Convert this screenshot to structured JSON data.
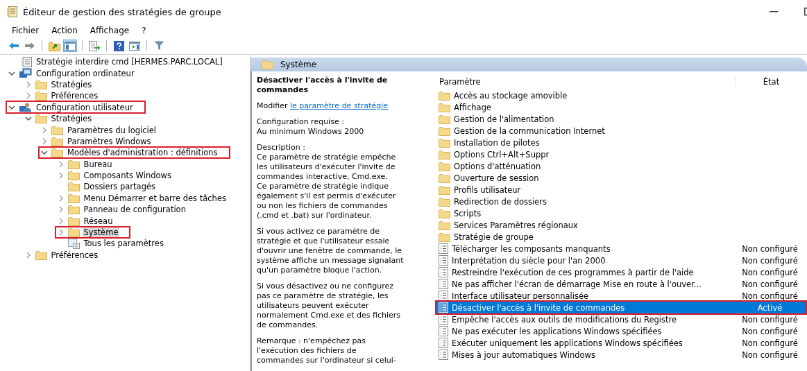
{
  "window": {
    "title": "Éditeur de gestion des stratégies de groupe"
  },
  "menu": [
    "Fichier",
    "Action",
    "Affichage",
    "?"
  ],
  "toolbar": [
    [
      {
        "kind": "back",
        "pressed": false
      },
      {
        "kind": "forward",
        "pressed": false
      }
    ],
    [
      {
        "kind": "up",
        "pressed": false
      },
      {
        "kind": "tree",
        "pressed": true
      }
    ],
    [
      {
        "kind": "export",
        "pressed": false
      }
    ],
    [
      {
        "kind": "help",
        "pressed": false
      },
      {
        "kind": "view",
        "pressed": false
      }
    ],
    [
      {
        "kind": "filter",
        "pressed": false
      }
    ]
  ],
  "tree": {
    "root": {
      "label": "Stratégie interdire cmd [HERMES.PARC.LOCAL]"
    },
    "children": [
      {
        "label": "Configuration ordinateur",
        "kind": "computer",
        "has_children": true,
        "expanded": true,
        "selected": false,
        "highlighted": false,
        "children": [
          {
            "label": "Stratégies",
            "kind": "folder",
            "has_children": true,
            "expanded": false,
            "selected": false,
            "highlighted": false
          },
          {
            "label": "Préférences",
            "kind": "folder",
            "has_children": true,
            "expanded": false,
            "selected": false,
            "highlighted": false
          }
        ]
      },
      {
        "label": "Configuration utilisateur",
        "kind": "user",
        "has_children": true,
        "expanded": true,
        "selected": false,
        "highlighted": true,
        "children": [
          {
            "label": "Stratégies",
            "kind": "folder",
            "has_children": true,
            "expanded": true,
            "selected": false,
            "highlighted": false,
            "children": [
              {
                "label": "Paramètres du logiciel",
                "kind": "folder",
                "has_children": true,
                "expanded": false,
                "selected": false,
                "highlighted": false
              },
              {
                "label": "Paramètres Windows",
                "kind": "folder",
                "has_children": true,
                "expanded": false,
                "selected": false,
                "highlighted": false
              },
              {
                "label": "Modèles d'administration : définitions",
                "kind": "folder",
                "has_children": true,
                "expanded": true,
                "selected": false,
                "highlighted": true,
                "children": [
                  {
                    "label": "Bureau",
                    "kind": "folder",
                    "has_children": true,
                    "expanded": false,
                    "selected": false,
                    "highlighted": false
                  },
                  {
                    "label": "Composants Windows",
                    "kind": "folder",
                    "has_children": true,
                    "expanded": false,
                    "selected": false,
                    "highlighted": false
                  },
                  {
                    "label": "Dossiers partagés",
                    "kind": "folder",
                    "has_children": false,
                    "selected": false,
                    "highlighted": false
                  },
                  {
                    "label": "Menu Démarrer et barre des tâches",
                    "kind": "folder",
                    "has_children": true,
                    "expanded": false,
                    "selected": false,
                    "highlighted": false
                  },
                  {
                    "label": "Panneau de configuration",
                    "kind": "folder",
                    "has_children": true,
                    "expanded": false,
                    "selected": false,
                    "highlighted": false
                  },
                  {
                    "label": "Réseau",
                    "kind": "folder",
                    "has_children": true,
                    "expanded": false,
                    "selected": false,
                    "highlighted": false
                  },
                  {
                    "label": "Système",
                    "kind": "folder",
                    "has_children": true,
                    "expanded": false,
                    "selected": true,
                    "highlighted": true
                  },
                  {
                    "label": "Tous les paramètres",
                    "kind": "settings",
                    "has_children": false,
                    "selected": false,
                    "highlighted": false
                  }
                ]
              }
            ]
          },
          {
            "label": "Préférences",
            "kind": "folder",
            "has_children": true,
            "expanded": false,
            "selected": false,
            "highlighted": false
          }
        ]
      }
    ]
  },
  "pane_header": "Système",
  "description": {
    "title": "Désactiver l'accès à l'invite de commandes",
    "edit_prefix": "Modifier",
    "edit_link": "le paramètre de stratégie",
    "paragraphs": [
      [
        "Configuration requise :",
        "Au minimum Windows 2000"
      ],
      [
        "Description :",
        "Ce paramètre de stratégie empêche",
        "les utilisateurs d'exécuter l'invite de",
        "commandes interactive, Cmd.exe.",
        "Ce paramètre de stratégie indique",
        "également s'il est permis d'exécuter",
        "ou non les fichiers de commandes",
        "(.cmd et .bat) sur l'ordinateur."
      ],
      [
        "Si vous activez ce paramètre de",
        "stratégie et que l'utilisateur essaie",
        "d'ouvrir une fenêtre de commande, le",
        "système affiche un message signalant",
        "qu'un paramètre bloque l'action."
      ],
      [
        "Si vous désactivez ou ne configurez",
        "pas ce paramètre de stratégie, les",
        "utilisateurs peuvent exécuter",
        "normalement Cmd.exe et des fichiers",
        "de commandes."
      ],
      [
        "Remarque : n'empêchez pas",
        "l'exécution des fichiers de",
        "commandes sur l'ordinateur si celui-"
      ]
    ]
  },
  "table": {
    "columns": [
      "Paramètre",
      "État"
    ],
    "rows": [
      {
        "kind": "folder",
        "name": "Accès au stockage amovible",
        "selected": false,
        "highlighted": false
      },
      {
        "kind": "folder",
        "name": "Affichage",
        "selected": false,
        "highlighted": false
      },
      {
        "kind": "folder",
        "name": "Gestion de l'alimentation",
        "selected": false,
        "highlighted": false
      },
      {
        "kind": "folder",
        "name": "Gestion de la communication Internet",
        "selected": false,
        "highlighted": false
      },
      {
        "kind": "folder",
        "name": "Installation de pilotes",
        "selected": false,
        "highlighted": false
      },
      {
        "kind": "folder",
        "name": "Options Ctrl+Alt+Suppr",
        "selected": false,
        "highlighted": false
      },
      {
        "kind": "folder",
        "name": "Options d'atténuation",
        "selected": false,
        "highlighted": false
      },
      {
        "kind": "folder",
        "name": "Ouverture de session",
        "selected": false,
        "highlighted": false
      },
      {
        "kind": "folder",
        "name": "Profils utilisateur",
        "selected": false,
        "highlighted": false
      },
      {
        "kind": "folder",
        "name": "Redirection de dossiers",
        "selected": false,
        "highlighted": false
      },
      {
        "kind": "folder",
        "name": "Scripts",
        "selected": false,
        "highlighted": false
      },
      {
        "kind": "folder",
        "name": "Services Paramètres régionaux",
        "selected": false,
        "highlighted": false
      },
      {
        "kind": "folder",
        "name": "Stratégie de groupe",
        "selected": false,
        "highlighted": false
      },
      {
        "kind": "setting",
        "name": "Télécharger les composants manquants",
        "state": "Non configuré",
        "selected": false,
        "highlighted": false
      },
      {
        "kind": "setting",
        "name": "Interprétation du siècle pour l'an 2000",
        "state": "Non configuré",
        "selected": false,
        "highlighted": false
      },
      {
        "kind": "setting",
        "name": "Restreindre l'exécution de ces programmes à partir de l'aide",
        "state": "Non configuré",
        "selected": false,
        "highlighted": false
      },
      {
        "kind": "setting",
        "name": "Ne pas afficher l'écran de démarrage Mise en route à l'ouver...",
        "state": "Non configuré",
        "selected": false,
        "highlighted": false
      },
      {
        "kind": "setting",
        "name": "Interface utilisateur personnalisée",
        "state": "Non configuré",
        "selected": false,
        "highlighted": false
      },
      {
        "kind": "setting",
        "name": "Désactiver l'accès à l'invite de commandes",
        "state": "Activé",
        "selected": true,
        "highlighted": true
      },
      {
        "kind": "setting",
        "name": "Empêche l'accès aux outils de modifications du Registre",
        "state": "Non configuré",
        "selected": false,
        "highlighted": false
      },
      {
        "kind": "setting",
        "name": "Ne pas exécuter les applications Windows spécifiées",
        "state": "Non configuré",
        "selected": false,
        "highlighted": false
      },
      {
        "kind": "setting",
        "name": "Exécuter uniquement les applications Windows spécifiées",
        "state": "Non configuré",
        "selected": false,
        "highlighted": false
      },
      {
        "kind": "setting",
        "name": "Mises à jour automatiques Windows",
        "state": "Non configuré",
        "selected": false,
        "highlighted": false
      }
    ]
  }
}
